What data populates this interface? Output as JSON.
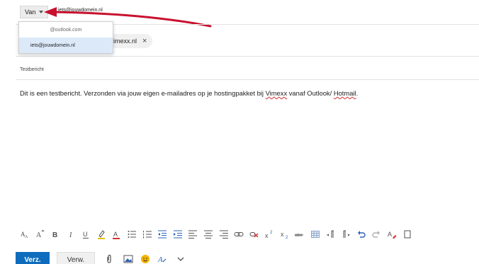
{
  "from": {
    "label": "Van",
    "address": "iets@jouwdomein.nl",
    "options": [
      "@outlook.com",
      "iets@jouwdomein.nl"
    ]
  },
  "to": {
    "chip_label": "imexx.nl",
    "remove_glyph": "×"
  },
  "subject": {
    "value": "Testbericht"
  },
  "body": {
    "part1": "Dit is een testbericht. Verzonden via jouw eigen e-mailadres op je hostingpakket bij ",
    "brand": "Vimexx",
    "part2": " vanaf Outlook/ ",
    "service": "Hotmail",
    "part3": "."
  },
  "toolbar": {
    "icons": [
      "font-size-icon",
      "font-grow-icon",
      "bold-icon",
      "italic-icon",
      "underline-icon",
      "highlight-icon",
      "font-color-icon",
      "bullet-list-icon",
      "numbered-list-icon",
      "decrease-indent-icon",
      "increase-indent-icon",
      "align-left-icon",
      "align-center-icon",
      "align-right-icon",
      "insert-link-icon",
      "remove-link-icon",
      "superscript-icon",
      "subscript-icon",
      "strikethrough-icon",
      "insert-table-icon",
      "ltr-icon",
      "rtl-icon",
      "undo-icon",
      "redo-icon",
      "clear-format-icon",
      "more-options-icon"
    ],
    "bold": "B",
    "italic": "I",
    "underline": "U",
    "strike": "abc"
  },
  "actions": {
    "send": "Verz.",
    "discard": "Verw."
  },
  "colors": {
    "accent": "#0f6cbd",
    "arrow": "#c8102e",
    "selected_bg": "#dbe9f9"
  }
}
